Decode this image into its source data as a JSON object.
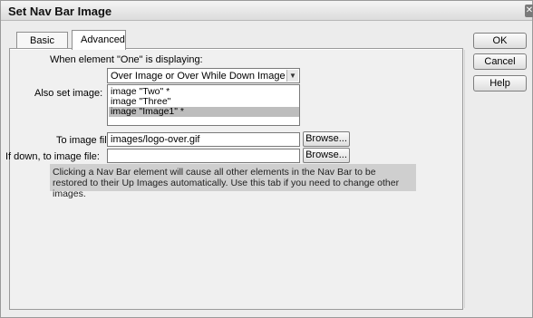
{
  "window": {
    "title": "Set Nav Bar Image",
    "close_glyph": "✕"
  },
  "tabs": [
    {
      "label": "Basic",
      "active": false
    },
    {
      "label": "Advanced",
      "active": true
    }
  ],
  "form": {
    "when_label": "When element \"One\" is displaying:",
    "state_select": {
      "value": "Over Image or Over While Down Image"
    },
    "also_set_label": "Also set image:",
    "images_list": [
      {
        "text": "image \"Two\" *",
        "selected": false
      },
      {
        "text": "image \"Three\"",
        "selected": false
      },
      {
        "text": "image \"Image1\" *",
        "selected": true
      }
    ],
    "to_image_label": "To image file:",
    "to_image_value": "images/logo-over.gif",
    "if_down_label": "If down, to image file:",
    "if_down_value": "",
    "browse_label": "Browse...",
    "note": "Clicking a Nav Bar element will cause all other elements in the Nav Bar to be restored to their Up Images automatically. Use this tab if you need to change other images."
  },
  "buttons": {
    "ok": "OK",
    "cancel": "Cancel",
    "help": "Help"
  }
}
